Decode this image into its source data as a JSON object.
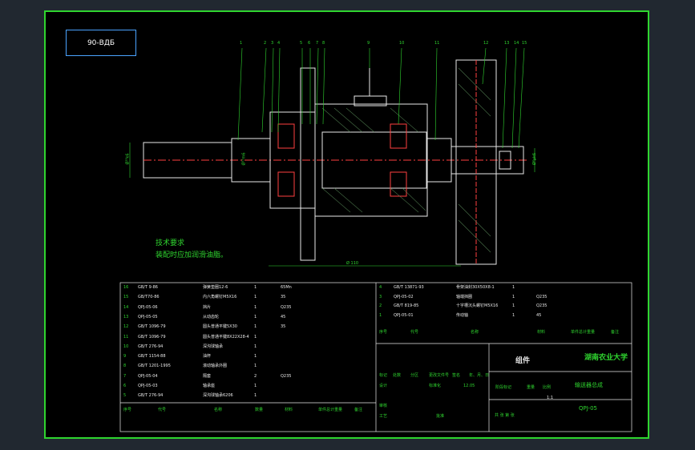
{
  "drawing_tag": "90-ΒДБ",
  "tech_req": {
    "title": "技术要求",
    "line1": "装配时应加润滑油脂。"
  },
  "callouts": [
    "1",
    "2",
    "3",
    "4",
    "5",
    "6",
    "7",
    "8",
    "9",
    "10",
    "11",
    "12",
    "13",
    "14",
    "15"
  ],
  "dims": {
    "shaft_left": "Ø³³k6",
    "shaft_mid": "Ø³³m6",
    "base_len": "Ø 110",
    "shaft_right": "Ø²µk6"
  },
  "parts_left": [
    {
      "no": "16",
      "code": "GB/T 9-86",
      "name": "弹簧垫圈12-6",
      "qty": "1",
      "mat": "65Mn"
    },
    {
      "no": "15",
      "code": "GB/T70-86",
      "name": "内六角螺钉M5X16",
      "qty": "1",
      "mat": "35"
    },
    {
      "no": "14",
      "code": "QPJ-05-06",
      "name": "挡片",
      "qty": "1",
      "mat": "Q235"
    },
    {
      "no": "13",
      "code": "QPJ-05-05",
      "name": "从动齿轮",
      "qty": "1",
      "mat": "45"
    },
    {
      "no": "12",
      "code": "GB/T 1096-79",
      "name": "圆头普通平键5X30",
      "qty": "1",
      "mat": "35"
    },
    {
      "no": "11",
      "code": "GB/T 1096-79",
      "name": "圆头普通平键8X22X28-4",
      "qty": "1",
      "mat": ""
    },
    {
      "no": "10",
      "code": "GB/T 276-94",
      "name": "深沟球轴承",
      "qty": "1",
      "mat": ""
    },
    {
      "no": "9",
      "code": "GB/T 1154-88",
      "name": "油杯",
      "qty": "1",
      "mat": ""
    },
    {
      "no": "8",
      "code": "GB/T 1201-1995",
      "name": "滚动轴承外圈",
      "qty": "1",
      "mat": ""
    },
    {
      "no": "7",
      "code": "QPJ-05-04",
      "name": "隔套",
      "qty": "2",
      "mat": "Q235"
    },
    {
      "no": "6",
      "code": "QPJ-05-03",
      "name": "轴承座",
      "qty": "1",
      "mat": ""
    },
    {
      "no": "5",
      "code": "GB/T 276-94",
      "name": "深沟球轴承6206",
      "qty": "1",
      "mat": ""
    }
  ],
  "parts_right": [
    {
      "no": "4",
      "code": "GB/T 13871-93",
      "name": "骨架油封30X50X8-1",
      "qty": "1",
      "mat": ""
    },
    {
      "no": "3",
      "code": "QPJ-05-02",
      "name": "轴端挡圈",
      "qty": "1",
      "mat": "Q235"
    },
    {
      "no": "2",
      "code": "GB/T 819-85",
      "name": "十字槽沉头螺钉M5X16",
      "qty": "1",
      "mat": "Q235"
    },
    {
      "no": "1",
      "code": "QPJ-05-01",
      "name": "传动轴",
      "qty": "1",
      "mat": "45"
    }
  ],
  "header": {
    "no": "序号",
    "code": "代号",
    "name": "名称",
    "qty": "数量",
    "mat": "材料",
    "wt": "单件总计重量",
    "note": "备注"
  },
  "title": {
    "assembly": "组件",
    "school": "湖南农业大学",
    "drawing_name": "输送器总成",
    "code": "QPJ-05",
    "rev_label": "标记",
    "zones": "处数",
    "area": "分区",
    "doc": "更改文件号",
    "sign": "签名",
    "date": "年、月、日",
    "designer": "设计",
    "std": "标准化",
    "year_val": "12.05",
    "stage": "阶段标记",
    "weight": "重量",
    "scale": "比例",
    "ratio": "1:1",
    "review": "审核",
    "process": "工艺",
    "approve": "批准",
    "sheets": "共 张 第 张"
  }
}
